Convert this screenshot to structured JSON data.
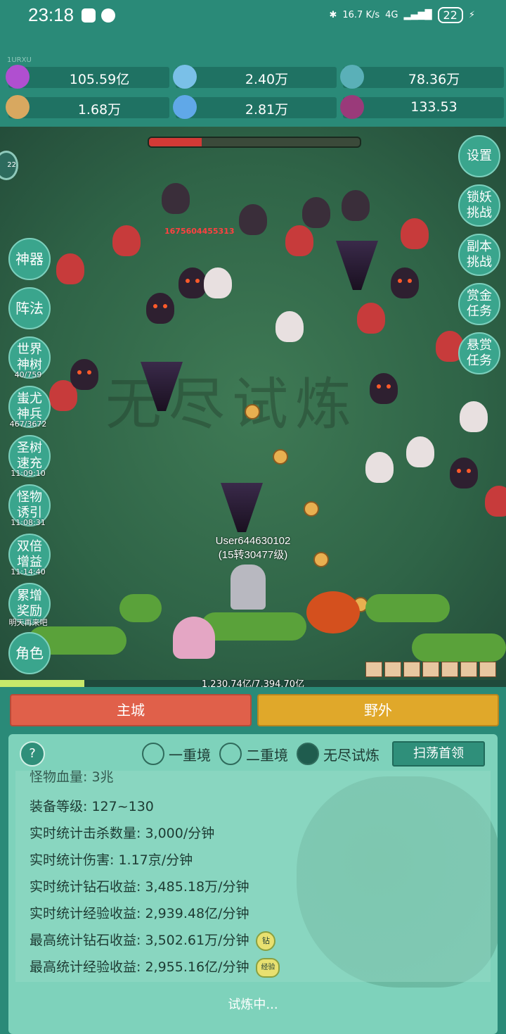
{
  "status": {
    "time": "23:18",
    "net_speed_top": "16.7",
    "net_speed_unit": "K/s",
    "network": "4G",
    "battery": "22"
  },
  "user_tag": "1URXU",
  "resources": [
    {
      "icon": "diamond-icon",
      "value": "105.59亿"
    },
    {
      "icon": "crystal-icon",
      "value": "2.40万"
    },
    {
      "icon": "ore-icon",
      "value": "78.36万"
    },
    {
      "icon": "scroll-icon",
      "value": "1.68万"
    },
    {
      "icon": "ice-gem-icon",
      "value": "2.81万"
    },
    {
      "icon": "potion-icon",
      "value": "133.53"
    }
  ],
  "game": {
    "damage_float": "1675604455313",
    "player_name": "User644630102",
    "player_level": "(15转30477级)",
    "boss_hp_fraction": 0.25,
    "xp_text": "1,230.74亿/7,394.70亿",
    "xp_fraction": 0.166,
    "circle_badge": "22"
  },
  "left_buttons": [
    {
      "label": "神器"
    },
    {
      "label": "阵法"
    },
    {
      "label": "世界神树",
      "sub": "40/759"
    },
    {
      "label": "蚩尤神兵",
      "sub": "467/3672"
    },
    {
      "label": "圣树速充",
      "sub": "11:09:10"
    },
    {
      "label": "怪物诱引",
      "sub": "11:08:31"
    },
    {
      "label": "双倍增益",
      "sub": "11:14:40"
    },
    {
      "label": "累增奖励",
      "sub": "明天再来吧"
    },
    {
      "label": "角色"
    }
  ],
  "right_buttons": [
    {
      "label": "设置"
    },
    {
      "label": "锁妖挑战"
    },
    {
      "label": "副本挑战"
    },
    {
      "label": "赏金任务"
    },
    {
      "label": "悬赏任务"
    }
  ],
  "nav": {
    "city": "主城",
    "wild": "野外"
  },
  "panel": {
    "help": "?",
    "modes": [
      "一重境",
      "二重境",
      "无尽试炼"
    ],
    "selected_mode": 2,
    "sweep": "扫荡首领",
    "stats": [
      "怪物血量: 3兆",
      "装备等级: 127~130",
      "实时统计击杀数量: 3,000/分钟",
      "实时统计伤害: 1.17京/分钟",
      "实时统计钻石收益: 3,485.18万/分钟",
      "实时统计经验收益: 2,939.48亿/分钟",
      "最高统计钻石收益: 3,502.61万/分钟",
      "最高统计经验收益: 2,955.16亿/分钟"
    ],
    "badge_diamond": "钻",
    "badge_exp": "经验",
    "status": "试炼中..."
  }
}
